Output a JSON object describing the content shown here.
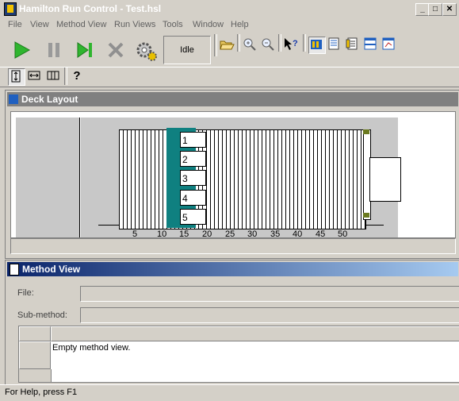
{
  "window": {
    "title": "Hamilton Run Control - Test.hsl",
    "min_label": "_",
    "max_label": "□",
    "close_label": "✕"
  },
  "menu": [
    "File",
    "View",
    "Method View",
    "Run Views",
    "Tools",
    "Window",
    "Help"
  ],
  "toolbar": {
    "status": "Idle",
    "icons": [
      "play-icon",
      "pause-icon",
      "step-icon",
      "abort-icon",
      "simulation-gear-icon",
      "open-folder-icon",
      "zoom-in-icon",
      "zoom-out-icon",
      "context-help-icon",
      "deck-layout-view-icon",
      "trace-view-icon",
      "method-view-icon",
      "split-view-icon",
      "window-view-icon"
    ]
  },
  "toolbar2": {
    "help_label": "?"
  },
  "deck_layout": {
    "title": "Deck Layout",
    "slots": [
      "1",
      "2",
      "3",
      "4",
      "5"
    ],
    "ruler": [
      "5",
      "10",
      "15",
      "20",
      "25",
      "30",
      "35",
      "40",
      "45",
      "50"
    ]
  },
  "method_view": {
    "title": "Method View",
    "file_label": "File:",
    "file_value": "",
    "submethod_label": "Sub-method:",
    "submethod_value": "",
    "grid_message": "Empty method view."
  },
  "statusbar": {
    "text": "For Help, press F1"
  }
}
